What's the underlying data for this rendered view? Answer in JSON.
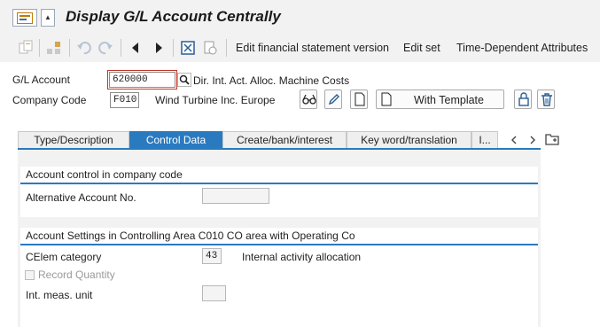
{
  "window": {
    "title": "Display G/L Account Centrally"
  },
  "toolbar": {
    "items": [
      {
        "icon": "copy-icon"
      },
      {
        "icon": "hierarchy-icon"
      },
      {
        "icon": "undo-icon"
      },
      {
        "icon": "redo-icon"
      },
      {
        "icon": "previous-icon"
      },
      {
        "icon": "next-icon"
      },
      {
        "icon": "delete-icon"
      },
      {
        "icon": "other-object-icon"
      }
    ],
    "edit_fs_version": "Edit financial statement version",
    "edit_set": "Edit set",
    "time_dependent": "Time-Dependent Attributes"
  },
  "header": {
    "gl_account_label": "G/L Account",
    "gl_account_value": "620000",
    "gl_account_desc": "Dir. Int. Act. Alloc. Machine Costs",
    "company_code_label": "Company Code",
    "company_code_value": "F010",
    "company_name": "Wind Turbine Inc. Europe",
    "with_template": "With Template"
  },
  "tabs": [
    {
      "label": "Type/Description",
      "active": false
    },
    {
      "label": "Control Data",
      "active": true
    },
    {
      "label": "Create/bank/interest",
      "active": false
    },
    {
      "label": "Key word/translation",
      "active": false
    },
    {
      "label": "I...",
      "active": false
    }
  ],
  "account_control": {
    "title": "Account control in company code",
    "alt_account_label": "Alternative Account No.",
    "alt_account_value": ""
  },
  "co_settings": {
    "title": "Account Settings in Controlling Area C010 CO area with Operating Co",
    "celem_category_label": "CElem category",
    "celem_category_value": "43",
    "celem_category_text": "Internal activity allocation",
    "record_quantity_label": "Record Quantity",
    "record_quantity_checked": false,
    "int_meas_unit_label": "Int. meas. unit",
    "int_meas_unit_value": ""
  },
  "colors": {
    "accent": "#2a7ac0",
    "focus": "#c0392b",
    "background": "#f2f2f2"
  }
}
